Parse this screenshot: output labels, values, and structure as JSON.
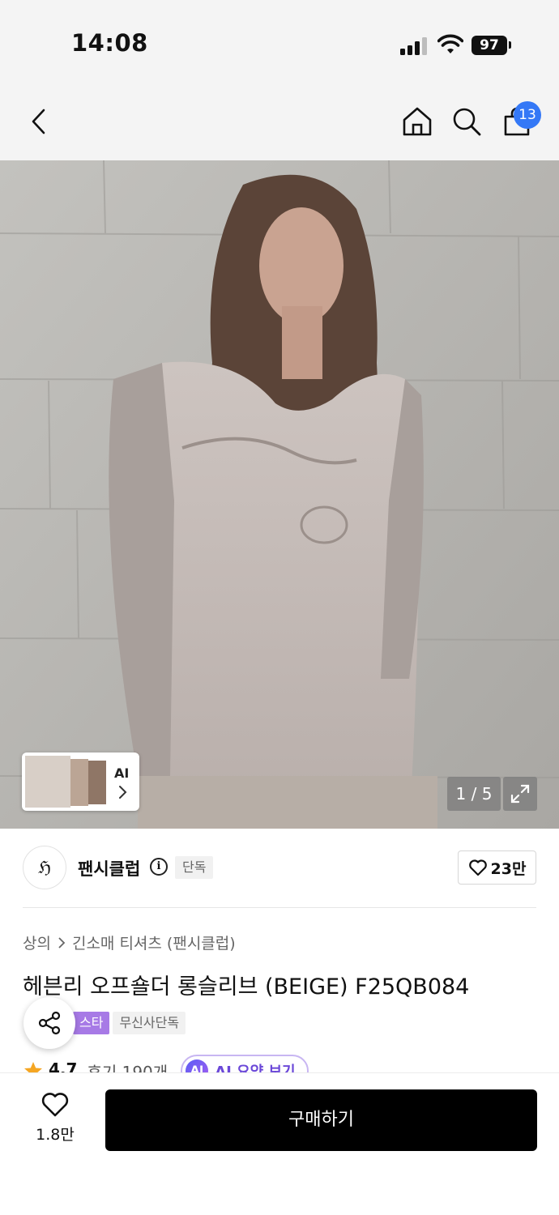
{
  "status_bar": {
    "time": "14:08",
    "battery": "97"
  },
  "nav": {
    "cart_count": "13"
  },
  "hero": {
    "thumb_label": "AI",
    "counter": "1 / 5"
  },
  "brand": {
    "logo_text": "ℌ",
    "name": "팬시클럽",
    "tag": "단독",
    "likes": "23만"
  },
  "product": {
    "breadcrumb": [
      "상의",
      "긴소매 티셔츠 (팬시클럽)"
    ],
    "title": "헤븐리 오프숄더 롱슬리브 (BEIGE) F25QB084",
    "badges": [
      "스타",
      "무신사단독"
    ],
    "rating": "4.7",
    "reviews": "후기 190개",
    "ai_summary": "AI 요약 보기",
    "ai_icon": "AI"
  },
  "bottom": {
    "wish_count": "1.8만",
    "buy_label": "구매하기"
  },
  "colors": {
    "accent_blue": "#3478f6",
    "badge_purple": "#a77ae6",
    "buy_button": "#000000"
  }
}
